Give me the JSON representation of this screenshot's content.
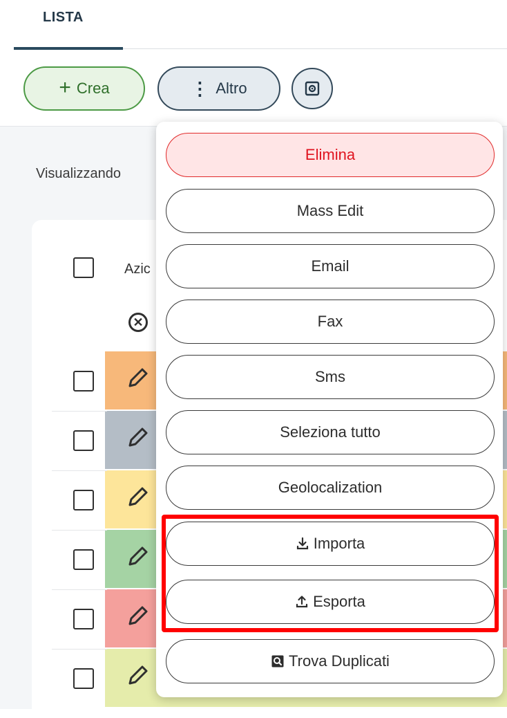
{
  "tabs": {
    "active_label": "LISTA"
  },
  "toolbar": {
    "create_label": "Crea",
    "more_label": "Altro",
    "create_icon": "plus-icon",
    "more_icon": "vertical-dots-icon",
    "settings_icon": "settings-box-icon"
  },
  "list": {
    "viewing_text": "Visualizzando",
    "actions_header": "Azic",
    "row_colors": [
      "#f7b87a",
      "#b4bdc6",
      "#fde59a",
      "#a5d3a4",
      "#f4a09c",
      "#e5ecab"
    ]
  },
  "menu": {
    "items": [
      {
        "label": "Elimina",
        "style": "danger"
      },
      {
        "label": "Mass Edit"
      },
      {
        "label": "Email"
      },
      {
        "label": "Fax"
      },
      {
        "label": "Sms"
      },
      {
        "label": "Seleziona tutto"
      },
      {
        "label": "Geolocalization"
      },
      {
        "label": "Importa",
        "icon": "download-icon"
      },
      {
        "label": "Esporta",
        "icon": "upload-icon"
      },
      {
        "label": "Trova Duplicati",
        "icon": "search-box-icon"
      }
    ]
  },
  "colors": {
    "create_border": "#4c9a45",
    "create_bg": "#e8f4e4",
    "danger_text": "#e0141f",
    "danger_bg": "#ffe5e6",
    "highlight": "#ff0000",
    "tab_accent": "#2a4a5e"
  }
}
